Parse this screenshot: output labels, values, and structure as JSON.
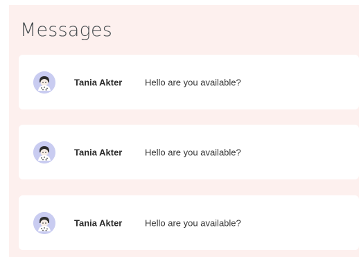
{
  "header": {
    "title": "Messages"
  },
  "messages": [
    {
      "sender": "Tania Akter",
      "preview": "Hello are you available?",
      "avatar_icon": "user-avatar-icon"
    },
    {
      "sender": "Tania Akter",
      "preview": "Hello are you available?",
      "avatar_icon": "user-avatar-icon"
    },
    {
      "sender": "Tania Akter",
      "preview": "Hello are you available?",
      "avatar_icon": "user-avatar-icon"
    }
  ],
  "colors": {
    "panel_bg": "#fdf0ee",
    "card_bg": "#ffffff",
    "avatar_bg": "#c9ccf1"
  }
}
